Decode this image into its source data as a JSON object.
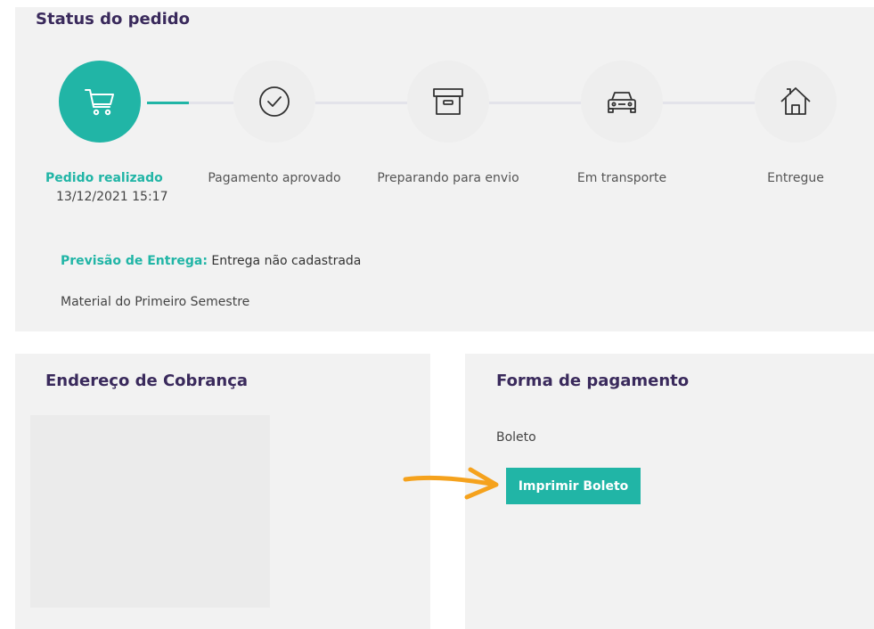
{
  "status": {
    "title": "Status do pedido",
    "steps": [
      {
        "label": "Pedido realizado",
        "date": "13/12/2021 15:17",
        "icon": "cart-icon",
        "active": true
      },
      {
        "label": "Pagamento aprovado",
        "icon": "check-circle-icon",
        "active": false
      },
      {
        "label": "Preparando para envio",
        "icon": "box-icon",
        "active": false
      },
      {
        "label": "Em transporte",
        "icon": "car-icon",
        "active": false
      },
      {
        "label": "Entregue",
        "icon": "house-icon",
        "active": false
      }
    ],
    "progress_fraction": 0.1,
    "forecast_label": "Previsão de Entrega:",
    "forecast_value": " Entrega não cadastrada",
    "description": "Material do Primeiro Semestre"
  },
  "billing": {
    "title": "Endereço de Cobrança"
  },
  "payment": {
    "title": "Forma de pagamento",
    "method": "Boleto",
    "print_button": "Imprimir Boleto"
  },
  "annotation": {
    "arrow_icon": "hand-drawn-arrow-icon",
    "arrow_color": "#f5a21d"
  },
  "colors": {
    "accent": "#21b5a6",
    "title": "#3a2a5c",
    "card": "#f2f2f2"
  }
}
